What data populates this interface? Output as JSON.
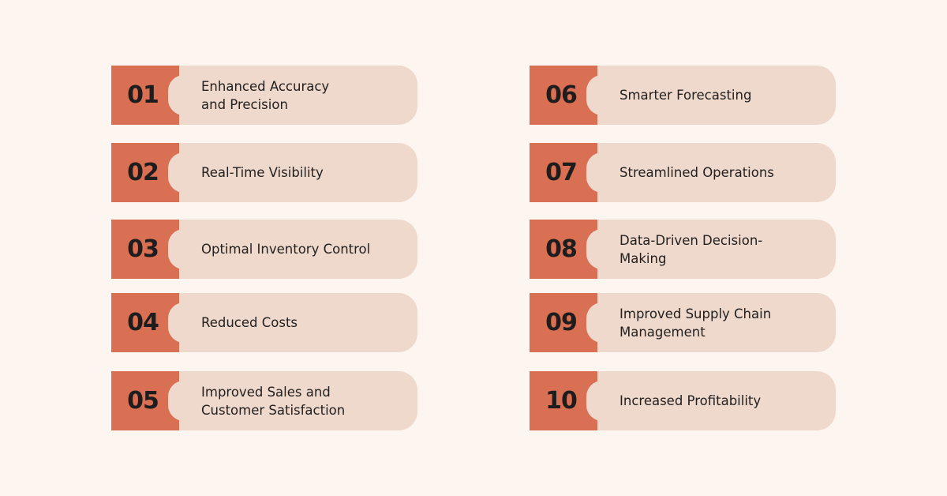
{
  "colors": {
    "background": "#fdf6f0",
    "number_box": "#d97053",
    "label_pill": "#eed9cc",
    "text": "#232020"
  },
  "items": [
    {
      "number": "01",
      "label": "Enhanced Accuracy\nand Precision"
    },
    {
      "number": "02",
      "label": "Real-Time Visibility"
    },
    {
      "number": "03",
      "label": "Optimal Inventory Control"
    },
    {
      "number": "04",
      "label": "Reduced Costs"
    },
    {
      "number": "05",
      "label": "Improved Sales and\nCustomer Satisfaction"
    },
    {
      "number": "06",
      "label": "Smarter Forecasting"
    },
    {
      "number": "07",
      "label": "Streamlined Operations"
    },
    {
      "number": "08",
      "label": "Data-Driven Decision-\nMaking"
    },
    {
      "number": "09",
      "label": "Improved Supply Chain\nManagement"
    },
    {
      "number": "10",
      "label": "Increased Profitability"
    }
  ]
}
